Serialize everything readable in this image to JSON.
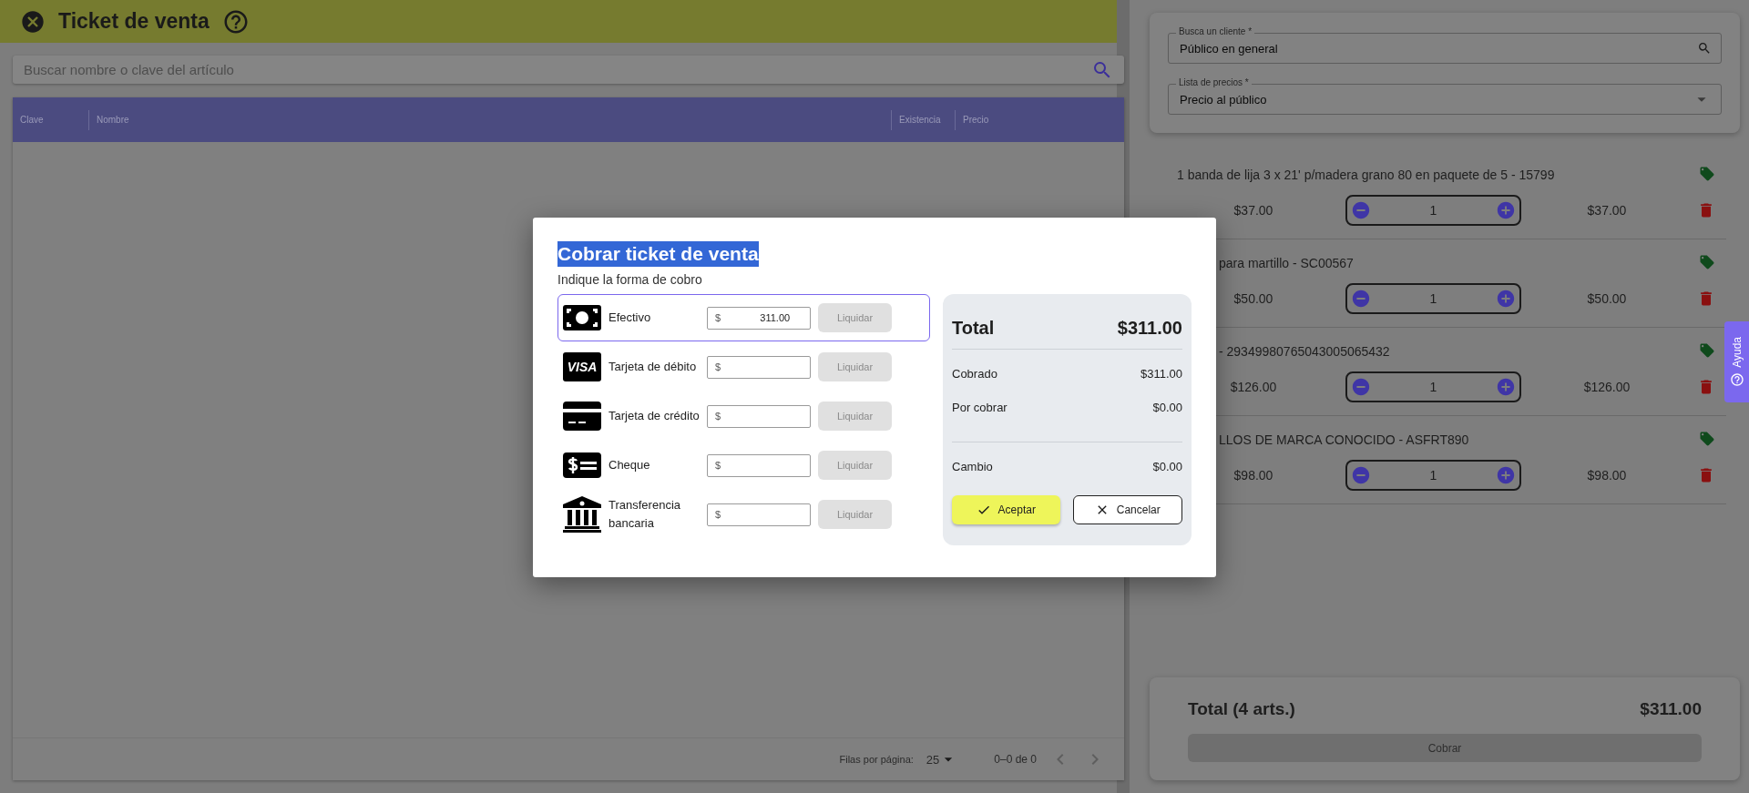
{
  "header": {
    "title": "Ticket de venta"
  },
  "search": {
    "placeholder": "Buscar nombre o clave del artículo"
  },
  "table": {
    "columns": [
      "Clave",
      "Nombre",
      "Existencia",
      "Precio"
    ]
  },
  "pagination": {
    "rows_label": "Filas por página:",
    "rows_value": "25",
    "range": "0–0 de 0"
  },
  "customer_field": {
    "label": "Busca un cliente *",
    "value": "Público en general"
  },
  "price_list_field": {
    "label": "Lista de precios *",
    "value": "Precio al público"
  },
  "cart_items": [
    {
      "name": "1 banda de lija 3 x 21' p/madera grano 80 en paquete de 5 - 15799",
      "cut": false,
      "price": "$37.00",
      "quantity": "1",
      "total": "$37.00"
    },
    {
      "name": "para martillo - SC00567",
      "cut": true,
      "price": "$50.00",
      "quantity": "1",
      "total": "$50.00"
    },
    {
      "name": "- 29349980765043005065432",
      "cut": true,
      "price": "$126.00",
      "quantity": "1",
      "total": "$126.00"
    },
    {
      "name": "LLOS DE MARCA CONOCIDO - ASFRT890",
      "cut": true,
      "price": "$98.00",
      "quantity": "1",
      "total": "$98.00"
    }
  ],
  "help_tab": {
    "label": "Ayuda"
  },
  "cart_footer": {
    "total_label": "Total (4 arts.)",
    "total_value": "$311.00",
    "button": {
      "label": "Cobrar",
      "disabled": true
    }
  },
  "dialog": {
    "title": {
      "text": "Cobrar ticket de venta",
      "highlighted": true
    },
    "subtitle": "Indique la forma de cobro",
    "methods": [
      {
        "kind": "cash",
        "label": "Efectivo",
        "selected": true,
        "currency": "$",
        "value": "311.00",
        "button": {
          "label": "Liquidar",
          "disabled": true
        }
      },
      {
        "kind": "visa",
        "badge": "VISA",
        "label": "Tarjeta de débito",
        "selected": false,
        "currency": "$",
        "button": {
          "label": "Liquidar",
          "disabled": true
        }
      },
      {
        "kind": "card",
        "label": "Tarjeta de crédito",
        "selected": false,
        "currency": "$",
        "button": {
          "label": "Liquidar",
          "disabled": true
        }
      },
      {
        "kind": "cheque",
        "label": "Cheque",
        "selected": false,
        "currency": "$",
        "button": {
          "label": "Liquidar",
          "disabled": true
        }
      },
      {
        "kind": "bank",
        "label": "Transferencia bancaria",
        "selected": false,
        "currency": "$",
        "button": {
          "label": "Liquidar",
          "disabled": true
        }
      }
    ],
    "summary": {
      "total_label": "Total",
      "total_value": "$311.00",
      "lines": [
        {
          "label": "Cobrado",
          "value": "$311.00"
        },
        {
          "label": "Por cobrar",
          "value": "$0.00"
        },
        {
          "label": "Cambio",
          "value": "$0.00"
        }
      ]
    },
    "buttons": [
      {
        "kind": "accept",
        "label": "Aceptar"
      },
      {
        "kind": "cancel",
        "label": "Cancelar"
      }
    ]
  }
}
